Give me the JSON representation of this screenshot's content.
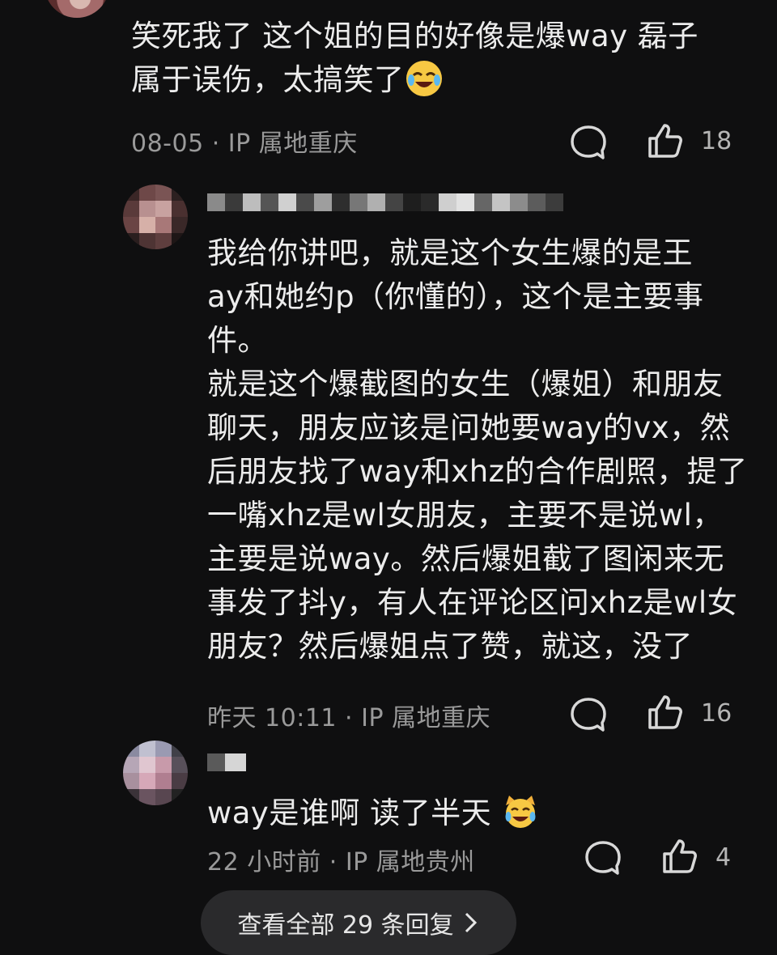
{
  "comment1": {
    "text_line1": "笑死我了 这个姐的目的好像是爆way 磊子",
    "text_line2": "属于误伤，太搞笑了",
    "emoji": "laughing-crying-emoji",
    "meta": "08-05 · IP 属地重庆",
    "likes": "18"
  },
  "reply1": {
    "lines": [
      "我给你讲吧，就是这个女生爆的是王",
      "ay和她约p（你懂的），这个是主要事",
      "件。",
      "就是这个爆截图的女生（爆姐）和朋友",
      "聊天，朋友应该是问她要way的vx，然",
      "后朋友找了way和xhz的合作剧照，提了",
      "一嘴xhz是wl女朋友，主要不是说wl，",
      "主要是说way。然后爆姐截了图闲来无",
      "事发了抖y，有人在评论区问xhz是wl女",
      "朋友？然后爆姐点了赞，就这，没了"
    ],
    "meta": "昨天 10:11 · IP 属地重庆",
    "likes": "16"
  },
  "reply2": {
    "text": "way是谁啊 读了半天",
    "emoji": "laughing-cat-emoji",
    "meta": "22 小时前 · IP 属地贵州",
    "likes": "4"
  },
  "view_all": {
    "label": "查看全部 29 条回复"
  },
  "colors": {
    "background": "#0f0f10",
    "text": "#ececec",
    "meta": "#9a9a9a",
    "emoji": "#f7c843"
  }
}
